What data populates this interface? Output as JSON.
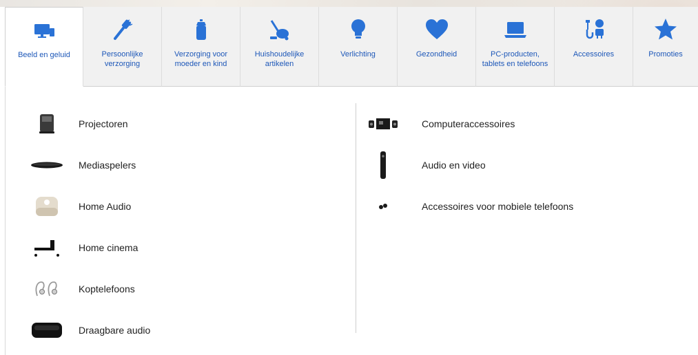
{
  "nav": {
    "tabs": [
      {
        "label": "Beeld en geluid",
        "icon": "tv-icon",
        "active": true
      },
      {
        "label": "Persoonlijke verzorging",
        "icon": "toothbrush-icon",
        "active": false
      },
      {
        "label": "Verzorging voor moeder en kind",
        "icon": "baby-bottle-icon",
        "active": false
      },
      {
        "label": "Huishoudelijke artikelen",
        "icon": "vacuum-icon",
        "active": false
      },
      {
        "label": "Verlichting",
        "icon": "lightbulb-icon",
        "active": false
      },
      {
        "label": "Gezondheid",
        "icon": "heart-icon",
        "active": false
      },
      {
        "label": "PC-producten, tablets en telefoons",
        "icon": "laptop-icon",
        "active": false
      },
      {
        "label": "Accessoires",
        "icon": "plug-icon",
        "active": false
      },
      {
        "label": "Promoties",
        "icon": "star-icon",
        "active": false
      }
    ]
  },
  "menu": {
    "left": [
      {
        "label": "Projectoren",
        "icon": "projector-icon"
      },
      {
        "label": "Mediaspelers",
        "icon": "media-player-icon"
      },
      {
        "label": "Home Audio",
        "icon": "home-audio-icon"
      },
      {
        "label": "Home cinema",
        "icon": "home-cinema-icon"
      },
      {
        "label": "Koptelefoons",
        "icon": "headphones-icon"
      },
      {
        "label": "Draagbare audio",
        "icon": "portable-speaker-icon"
      }
    ],
    "right": [
      {
        "label": "Computeraccessoires",
        "icon": "computer-speakers-icon"
      },
      {
        "label": "Audio en video",
        "icon": "remote-control-icon"
      },
      {
        "label": "Accessoires voor mobiele telefoons",
        "icon": "earbuds-icon"
      }
    ]
  },
  "colors": {
    "accent": "#1d57b8",
    "tab_bg": "#f1f1f1",
    "active_bg": "#ffffff"
  }
}
